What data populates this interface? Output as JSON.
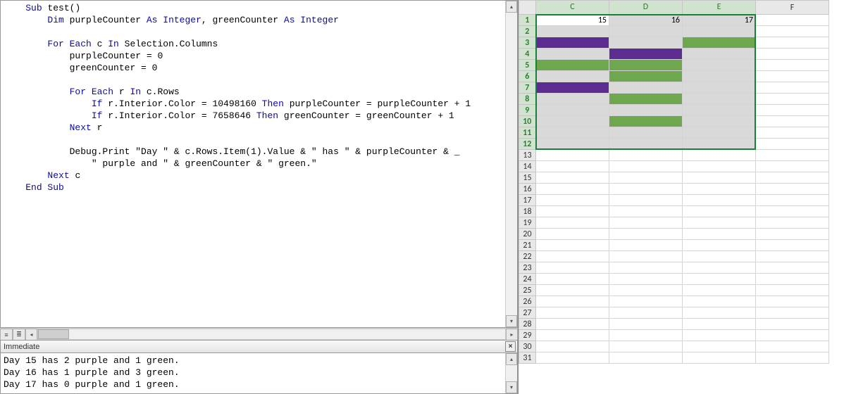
{
  "code": {
    "lines": [
      {
        "ind": 1,
        "parts": [
          {
            "t": "Sub ",
            "c": "kw"
          },
          {
            "t": "test()",
            "c": "txt"
          }
        ]
      },
      {
        "ind": 2,
        "parts": [
          {
            "t": "Dim ",
            "c": "kw"
          },
          {
            "t": "purpleCounter ",
            "c": "txt"
          },
          {
            "t": "As Integer",
            "c": "kw"
          },
          {
            "t": ", greenCounter ",
            "c": "txt"
          },
          {
            "t": "As Integer",
            "c": "kw"
          }
        ]
      },
      {
        "ind": 0,
        "parts": [
          {
            "t": "",
            "c": "txt"
          }
        ]
      },
      {
        "ind": 2,
        "parts": [
          {
            "t": "For Each ",
            "c": "kw"
          },
          {
            "t": "c ",
            "c": "txt"
          },
          {
            "t": "In ",
            "c": "kw"
          },
          {
            "t": "Selection.Columns",
            "c": "txt"
          }
        ]
      },
      {
        "ind": 3,
        "parts": [
          {
            "t": "purpleCounter = 0",
            "c": "txt"
          }
        ]
      },
      {
        "ind": 3,
        "parts": [
          {
            "t": "greenCounter = 0",
            "c": "txt"
          }
        ]
      },
      {
        "ind": 0,
        "parts": [
          {
            "t": "",
            "c": "txt"
          }
        ]
      },
      {
        "ind": 3,
        "parts": [
          {
            "t": "For Each ",
            "c": "kw"
          },
          {
            "t": "r ",
            "c": "txt"
          },
          {
            "t": "In ",
            "c": "kw"
          },
          {
            "t": "c.Rows",
            "c": "txt"
          }
        ]
      },
      {
        "ind": 4,
        "parts": [
          {
            "t": "If ",
            "c": "kw"
          },
          {
            "t": "r.Interior.Color = 10498160 ",
            "c": "txt"
          },
          {
            "t": "Then ",
            "c": "kw"
          },
          {
            "t": "purpleCounter = purpleCounter + 1",
            "c": "txt"
          }
        ]
      },
      {
        "ind": 4,
        "parts": [
          {
            "t": "If ",
            "c": "kw"
          },
          {
            "t": "r.Interior.Color = 7658646 ",
            "c": "txt"
          },
          {
            "t": "Then ",
            "c": "kw"
          },
          {
            "t": "greenCounter = greenCounter + 1",
            "c": "txt"
          }
        ]
      },
      {
        "ind": 3,
        "parts": [
          {
            "t": "Next ",
            "c": "kw"
          },
          {
            "t": "r",
            "c": "txt"
          }
        ]
      },
      {
        "ind": 0,
        "parts": [
          {
            "t": "",
            "c": "txt"
          }
        ]
      },
      {
        "ind": 3,
        "parts": [
          {
            "t": "Debug.Print \"Day \" & c.Rows.Item(1).Value & \" has \" & purpleCounter & _",
            "c": "txt"
          }
        ]
      },
      {
        "ind": 4,
        "parts": [
          {
            "t": "\" purple and \" & greenCounter & \" green.\"",
            "c": "txt"
          }
        ]
      },
      {
        "ind": 2,
        "parts": [
          {
            "t": "Next ",
            "c": "kw"
          },
          {
            "t": "c",
            "c": "txt"
          }
        ]
      },
      {
        "ind": 1,
        "parts": [
          {
            "t": "End Sub",
            "c": "kw"
          }
        ]
      }
    ]
  },
  "immediate": {
    "title": "Immediate",
    "lines": [
      "Day 15 has 2 purple and 1 green.",
      "Day 16 has 1 purple and 3 green.",
      "Day 17 has 0 purple and 1 green."
    ]
  },
  "sheet": {
    "columns": [
      "C",
      "D",
      "E",
      "F"
    ],
    "selectedCols": [
      "C",
      "D",
      "E"
    ],
    "rowCount": 31,
    "selectedRows": [
      1,
      2,
      3,
      4,
      5,
      6,
      7,
      8,
      9,
      10,
      11,
      12
    ],
    "activeCell": {
      "row": 1,
      "col": "C"
    },
    "values": {
      "1": {
        "C": "15",
        "D": "16",
        "E": "17"
      }
    },
    "fills": {
      "3": {
        "C": "purple",
        "E": "green"
      },
      "4": {
        "D": "purple"
      },
      "5": {
        "C": "green",
        "D": "green"
      },
      "6": {
        "D": "green"
      },
      "7": {
        "C": "purple"
      },
      "8": {
        "D": "green"
      },
      "10": {
        "D": "green"
      }
    }
  }
}
